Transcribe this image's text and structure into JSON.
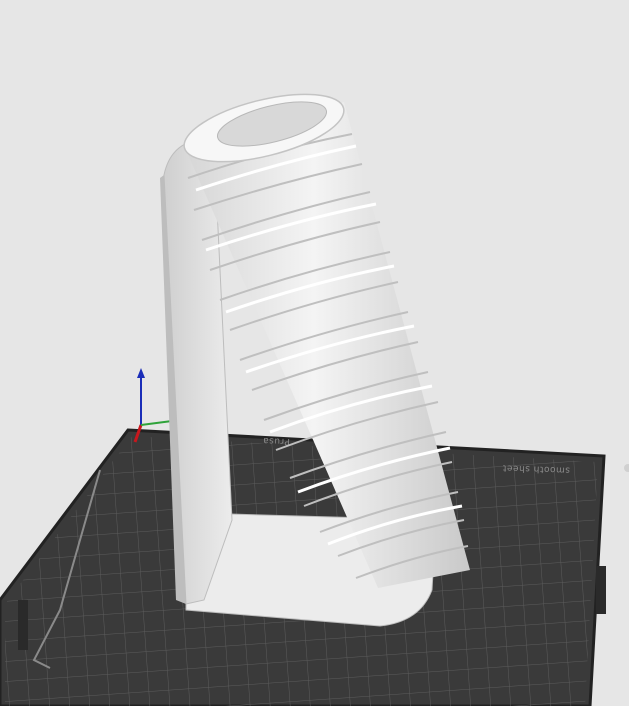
{
  "viewport": {
    "background": "#e6e6e6",
    "bed": {
      "label_front": "bed-label-front",
      "label_right": "bed-label-right",
      "surface_color": "#3b3b3b",
      "grid_color": "#6a6a6a",
      "edge_color": "#222222"
    },
    "model": {
      "color": "#f2f2f2",
      "shadow": "#bdbdbd"
    },
    "axes": {
      "z_color": "#1a2db8",
      "x_color": "#c8171d",
      "y_color": "#2fa33a"
    }
  }
}
